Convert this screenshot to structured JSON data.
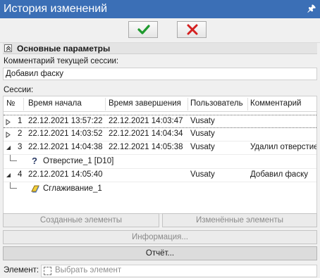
{
  "window": {
    "title": "История изменений"
  },
  "basic_section": {
    "title": "Основные параметры"
  },
  "comment": {
    "label": "Комментарий текущей сессии:",
    "value": "Добавил фаску"
  },
  "sessions": {
    "label": "Сессии:",
    "columns": [
      "№",
      "Время начала",
      "Время завершения",
      "Пользователь",
      "Комментарий"
    ],
    "rows": [
      {
        "num": "1",
        "start": "22.12.2021 13:57:22",
        "end": "22.12.2021 14:03:47",
        "user": "Vusaty",
        "comment": "",
        "state": "collapsed"
      },
      {
        "num": "2",
        "start": "22.12.2021 14:03:52",
        "end": "22.12.2021 14:04:34",
        "user": "Vusaty",
        "comment": "",
        "state": "collapsed"
      },
      {
        "num": "3",
        "start": "22.12.2021 14:04:38",
        "end": "22.12.2021 14:05:38",
        "user": "Vusaty",
        "comment": "Удалил отверстие",
        "state": "expanded"
      },
      {
        "child": "Отверстие_1 [D10]",
        "icon": "question-icon"
      },
      {
        "num": "4",
        "start": "22.12.2021 14:05:40",
        "end": "",
        "user": "Vusaty",
        "comment": "Добавил фаску",
        "state": "expanded"
      },
      {
        "child": "Сглаживание_1",
        "icon": "fillet-icon"
      }
    ]
  },
  "buttons": {
    "created": "Созданные элементы",
    "modified": "Изменённые элементы",
    "info": "Информация...",
    "report": "Отчёт..."
  },
  "element": {
    "label": "Элемент:",
    "placeholder": "Выбрать элемент"
  }
}
